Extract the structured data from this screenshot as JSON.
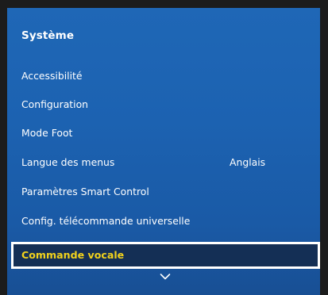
{
  "panel": {
    "title": "Système"
  },
  "menu": {
    "items": [
      {
        "label": "Accessibilité"
      },
      {
        "label": "Configuration"
      },
      {
        "label": "Mode Foot"
      },
      {
        "label": "Langue des menus",
        "value": "Anglais"
      },
      {
        "label": "Paramètres Smart Control"
      },
      {
        "label": "Config. télécommande universelle"
      }
    ],
    "selected": {
      "label": "Commande vocale",
      "highlight_color": "#f2d21c"
    }
  },
  "icons": {
    "scroll_down": "chevron-down-icon"
  },
  "colors": {
    "panel_blue": "#1c62b1",
    "selected_bg": "#142f55",
    "selected_border": "#ffffff"
  }
}
